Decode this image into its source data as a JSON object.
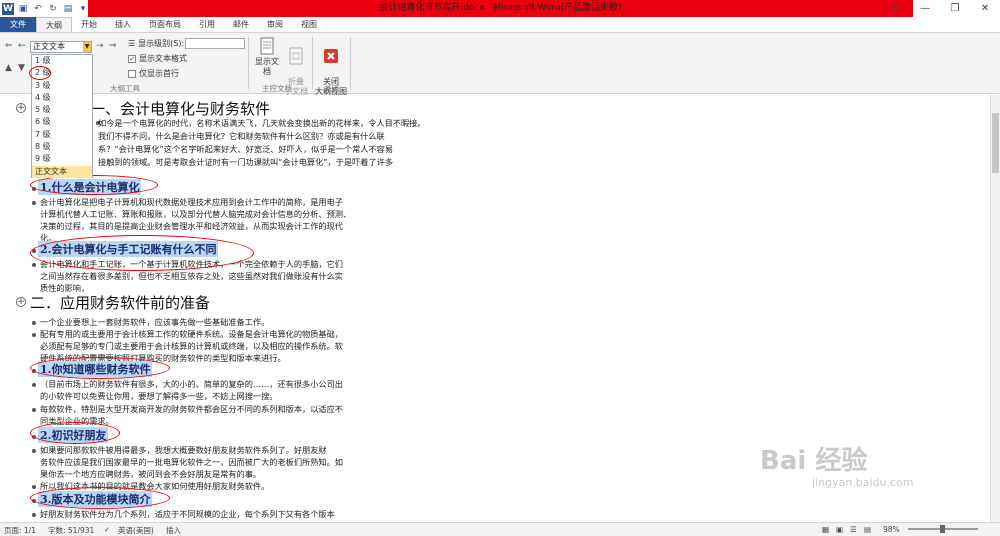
{
  "window": {
    "title": "会计电算化节节高升.docx - Microsoft Word(产品激活失败)",
    "controls": [
      "?",
      "—",
      "❐",
      "✕"
    ]
  },
  "ribbon_tabs": [
    {
      "label": "文件"
    },
    {
      "label": "大纲"
    },
    {
      "label": "开始"
    },
    {
      "label": "插入"
    },
    {
      "label": "页面布局"
    },
    {
      "label": "引用"
    },
    {
      "label": "邮件"
    },
    {
      "label": "审阅"
    },
    {
      "label": "视图"
    }
  ],
  "outline_tools": {
    "level_value": "正文文本",
    "show_level_label": "显示级别(S):",
    "show_text_format_label": "显示文本格式",
    "show_text_format_checked": true,
    "show_first_line_label": "仅显示首行",
    "show_first_line_checked": false,
    "group_label": "大纲工具"
  },
  "master_doc": {
    "show_doc_label": "显示文档",
    "collapse_label": "折叠\n子文档",
    "group_label": "主控文档"
  },
  "close": {
    "label": "关闭\n大纲视图",
    "group_label": "关闭"
  },
  "level_dropdown": [
    "1 级",
    "2 级",
    "3 级",
    "4 级",
    "5 级",
    "6 级",
    "7 级",
    "8 级",
    "9 级",
    "正文文本"
  ],
  "document": {
    "h1_a": "一、会计电算化与财务软件",
    "p1_l1": "如今是一个电算化的时代，名称术语满天飞，几天就会变换出新的花样来，令人目不暇接。",
    "p1_l2": "我们不得不问，什么是会计电算化？它和财务软件有什么区别？亦或是有什么联",
    "p1_l3": "系？“会计电算化”这个名字听起来好大、好宽泛、好吓人，似乎是一个常人不容易",
    "p1_l4": "接触到的领域。可是考取会计证时有一门功课就叫“会计电算化”，于是吓着了许多",
    "h2_1": "1.什么是会计电算化",
    "p2_l1": "会计电算化是把电子计算机和现代数据处理技术应用到会计工作中的简称，是用电子",
    "p2_l2": "计算机代替人工记账、算账和报账，以及部分代替人脑完成对会计信息的分析、预测、",
    "p2_l3": "决策的过程，其目的是提高企业财会管理水平和经济效益，从而实现会计工作的现代",
    "p2_l4": "化。",
    "h2_2": "2.会计电算化与手工记账有什么不同",
    "p3_l1": "会计电算化和手工记账，一个基于计算机软件技术，一个完全依赖于人的手脑，它们",
    "p3_l2": "之间当然存在着很多差别，但也不乏相互依存之处，这些虽然对我们做账没有什么实",
    "p3_l3": "质性的影响，",
    "h1_b": "二．应用财务软件前的准备",
    "p4": "一个企业要想上一套财务软件，应该事先做一些基础准备工作。",
    "p5_l1": "配有专用的或主要用于会计核算工作的软硬件系统。设备是会计电算化的物质基础，",
    "p5_l2": "必须配有足够的专门或主要用于会计核算的计算机或终端，以及相应的操作系统。软",
    "p5_l3": "硬件系统的配置需要按照打算购买的财务软件的类型和版本来进行。",
    "h2_3": "1.你知道哪些财务软件",
    "p6_l1": "（目前市场上的财务软件有很多，大的小的、简单的复杂的……，还有很多小公司出",
    "p6_l2": "的小软件可以免费让你用，要想了解得多一些，不妨上网搜一搜。",
    "p7_l1": "每款软件，特别是大型开发商开发的财务软件都会区分不同的系列和版本，以适应不",
    "p7_l2": "同类型企业的需求。",
    "h2_4": "2.初识好朋友",
    "p8_l1": "如果要问那款软件被用得最多，我想大概要数好朋友财务软件系列了。好朋友财",
    "p8_l2": "务软件应该是我们国家最早的一批电算化软件之一，因而被广大的老板们所熟知。如",
    "p8_l3": "果你去一个地方应聘财务，被问到会不会好朋友是常有的事。",
    "p9": "所以我们这本书的目的就是教会大家如何使用好朋友财务软件。",
    "h2_5": "3.版本及功能模块简介",
    "p10": "好朋友财务软件分为几个系列，适应于不同规模的企业，每个系列下又有各个版本"
  },
  "status": {
    "page": "页面: 1/1",
    "words": "字数: 51/931",
    "language": "英语(美国)",
    "mode": "插入",
    "zoom": "98%"
  },
  "watermark": {
    "main": "Bai 经验",
    "sub": "jingyan.baidu.com"
  },
  "colors": {
    "file_tab": "#2b579a",
    "title_bar": "#e8000e",
    "heading_highlight": "#b9d7f5",
    "annotation": "#e00000"
  }
}
